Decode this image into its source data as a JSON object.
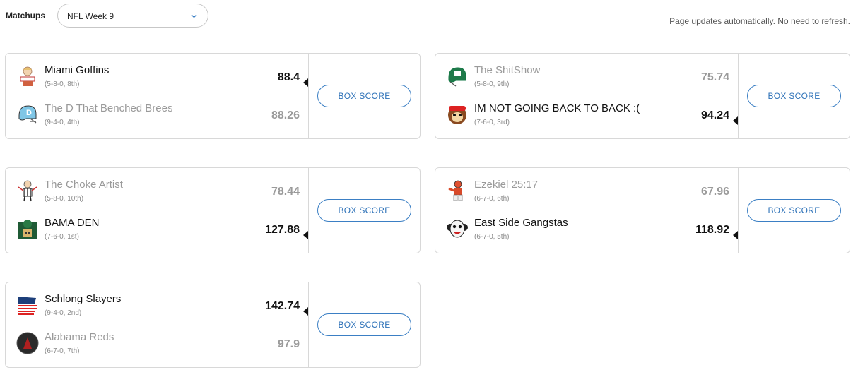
{
  "header": {
    "matchups_label": "Matchups",
    "week_select": {
      "selected": "NFL Week 9"
    },
    "auto_update_note": "Page updates automatically. No need to refresh."
  },
  "box_score_label": "BOX SCORE",
  "matchups": [
    {
      "teams": [
        {
          "name": "Miami Goffins",
          "record": "(5-8-0, 8th)",
          "score": "88.4",
          "winner": true,
          "logo": "cartoon-person-logo"
        },
        {
          "name": "The D That Benched Brees",
          "record": "(9-4-0, 4th)",
          "score": "88.26",
          "winner": false,
          "logo": "helmet-logo"
        }
      ]
    },
    {
      "teams": [
        {
          "name": "The ShitShow",
          "record": "(5-8-0, 9th)",
          "score": "75.74",
          "winner": false,
          "logo": "green-helmet-logo"
        },
        {
          "name": "IM NOT GOING BACK TO BACK :(",
          "record": "(7-6-0, 3rd)",
          "score": "94.24",
          "winner": true,
          "logo": "monkey-logo"
        }
      ]
    },
    {
      "teams": [
        {
          "name": "The Choke Artist",
          "record": "(5-8-0, 10th)",
          "score": "78.44",
          "winner": false,
          "logo": "referee-logo"
        },
        {
          "name": "BAMA DEN",
          "record": "(7-6-0, 1st)",
          "score": "127.88",
          "winner": true,
          "logo": "green-building-logo"
        }
      ]
    },
    {
      "teams": [
        {
          "name": "Ezekiel 25:17",
          "record": "(6-7-0, 6th)",
          "score": "67.96",
          "winner": false,
          "logo": "football-player-logo"
        },
        {
          "name": "East Side Gangstas",
          "record": "(6-7-0, 5th)",
          "score": "118.92",
          "winner": true,
          "logo": "clown-logo"
        }
      ]
    },
    {
      "teams": [
        {
          "name": "Schlong Slayers",
          "record": "(9-4-0, 2nd)",
          "score": "142.74",
          "winner": true,
          "logo": "playoffs-flag-logo"
        },
        {
          "name": "Alabama Reds",
          "record": "(6-7-0, 7th)",
          "score": "97.9",
          "winner": false,
          "logo": "dark-circle-logo"
        }
      ]
    }
  ]
}
